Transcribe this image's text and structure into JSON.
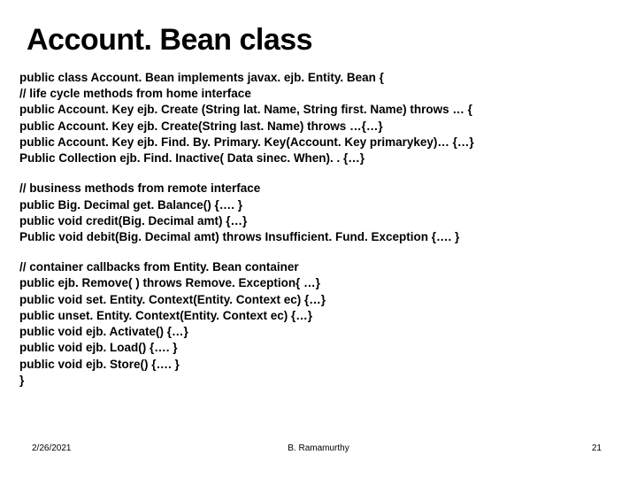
{
  "title": "Account. Bean class",
  "block1": {
    "l1": "public class Account. Bean implements javax. ejb. Entity. Bean {",
    "l2": "// life cycle methods from home interface",
    "l3": "public Account. Key ejb. Create (String lat. Name, String first. Name) throws … {",
    "l4": "public Account. Key ejb. Create(String last. Name) throws …{…}",
    "l5": "public Account. Key ejb. Find. By. Primary. Key(Account. Key primarykey)… {…}",
    "l6": "Public Collection ejb. Find. Inactive( Data sinec. When). . {…}"
  },
  "block2": {
    "l1": "// business methods from remote interface",
    "l2": "public Big. Decimal get. Balance() {…. }",
    "l3": "public void credit(Big. Decimal amt) {…}",
    "l4": "Public void debit(Big. Decimal amt) throws Insufficient. Fund. Exception {…. }"
  },
  "block3": {
    "l1": "// container callbacks from Entity. Bean container",
    "l2": "public ejb. Remove( ) throws Remove. Exception{ …}",
    "l3": "public void set. Entity. Context(Entity. Context ec) {…}",
    "l4": "public unset. Entity. Context(Entity. Context ec) {…}",
    "l5": "public void ejb. Activate() {…}",
    "l6": "public void ejb. Load() {…. }",
    "l7": "public void  ejb. Store() {…. }",
    "l8": "}"
  },
  "footer": {
    "date": "2/26/2021",
    "author": "B. Ramamurthy",
    "page": "21"
  }
}
